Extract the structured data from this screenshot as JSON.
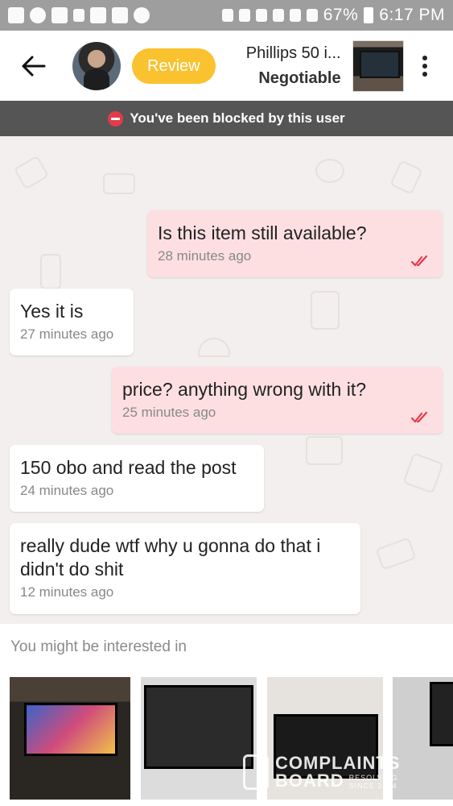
{
  "status_bar": {
    "battery": "67%",
    "time": "6:17 PM"
  },
  "header": {
    "review_label": "Review",
    "item_title": "Phillips 50 i...",
    "item_price": "Negotiable"
  },
  "banner": {
    "text": "You've been blocked by this user"
  },
  "messages": [
    {
      "text": "Is this item still available?",
      "time": "28 minutes ago",
      "sender": "me"
    },
    {
      "text": "Yes it is",
      "time": "27 minutes ago",
      "sender": "them"
    },
    {
      "text": "price? anything wrong with it?",
      "time": "25 minutes ago",
      "sender": "me"
    },
    {
      "text": "150 obo and read the post",
      "time": "24 minutes ago",
      "sender": "them"
    },
    {
      "text": "really dude wtf why u gonna do that i didn't do shit",
      "time": "12 minutes ago",
      "sender": "them"
    }
  ],
  "suggestions": {
    "title": "You might be interested in"
  },
  "watermark": {
    "line1": "COMPLAINTS",
    "line2": "BOARD",
    "line3": "RESOLVING",
    "line4": "SINCE 2004"
  },
  "colors": {
    "my_bubble": "#fddfe2",
    "their_bubble": "#ffffff",
    "review_button": "#fbc230",
    "banner_bg": "#555555",
    "blocked_icon": "#e53a4b",
    "read_ticks": "#e53a4b"
  }
}
